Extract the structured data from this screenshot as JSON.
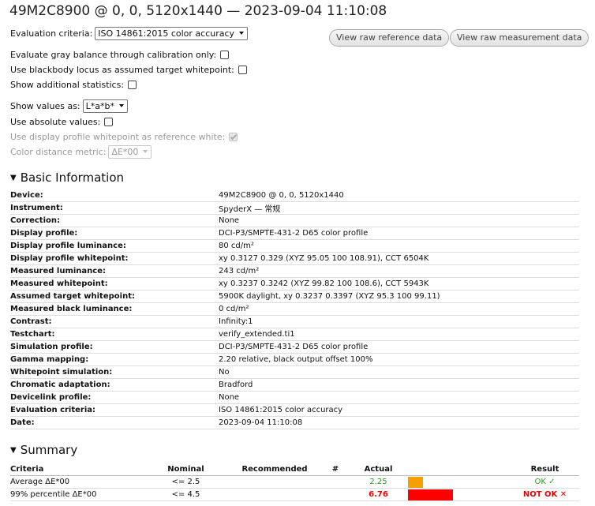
{
  "title": "49M2C8900 @ 0, 0, 5120x1440 — 2023-09-04 11:10:08",
  "controls": {
    "criteria_label": "Evaluation criteria:",
    "criteria_value": "ISO 14861:2015 color accuracy",
    "gray_balance_label": "Evaluate gray balance through calibration only:",
    "blackbody_label": "Use blackbody locus as assumed target whitepoint:",
    "additional_stats_label": "Show additional statistics:",
    "show_values_label": "Show values as:",
    "show_values_value": "L*a*b*",
    "absolute_values_label": "Use absolute values:",
    "display_profile_wp_label": "Use display profile whitepoint as reference white:",
    "color_distance_label": "Color distance metric:",
    "color_distance_value": "ΔE*00"
  },
  "buttons": {
    "raw_reference": "View raw reference data",
    "raw_measurement": "View raw measurement data"
  },
  "basic_info": {
    "heading": "Basic Information",
    "rows": [
      {
        "key": "Device:",
        "value": "49M2C8900 @ 0, 0, 5120x1440"
      },
      {
        "key": "Instrument:",
        "value": "SpyderX — 常规"
      },
      {
        "key": "Correction:",
        "value": "None"
      },
      {
        "key": "Display profile:",
        "value": "DCI-P3/SMPTE-431-2 D65 color profile"
      },
      {
        "key": "Display profile luminance:",
        "value": "80 cd/m²"
      },
      {
        "key": "Display profile whitepoint:",
        "value": "xy 0.3127 0.329 (XYZ 95.05 100 108.91), CCT 6504K"
      },
      {
        "key": "Measured luminance:",
        "value": "243 cd/m²"
      },
      {
        "key": "Measured whitepoint:",
        "value": "xy 0.3237 0.3242 (XYZ 99.82 100 108.6), CCT 5943K"
      },
      {
        "key": "Assumed target whitepoint:",
        "value": "5900K daylight, xy 0.3237 0.3397 (XYZ 95.3 100 99.11)"
      },
      {
        "key": "Measured black luminance:",
        "value": "0 cd/m²"
      },
      {
        "key": "Contrast:",
        "value": "Infinity:1"
      },
      {
        "key": "Testchart:",
        "value": "verify_extended.ti1"
      },
      {
        "key": "Simulation profile:",
        "value": "DCI-P3/SMPTE-431-2 D65 color profile"
      },
      {
        "key": "Gamma mapping:",
        "value": "2.20 relative, black output offset 100%"
      },
      {
        "key": "Whitepoint simulation:",
        "value": "No"
      },
      {
        "key": "Chromatic adaptation:",
        "value": "Bradford"
      },
      {
        "key": "Devicelink profile:",
        "value": "None"
      },
      {
        "key": "Evaluation criteria:",
        "value": "ISO 14861:2015 color accuracy"
      },
      {
        "key": "Date:",
        "value": "2023-09-04 11:10:08"
      }
    ]
  },
  "summary": {
    "heading": "Summary",
    "headers": {
      "criteria": "Criteria",
      "nominal": "Nominal",
      "recommended": "Recommended",
      "num": "#",
      "actual": "Actual",
      "result": "Result"
    },
    "rows": [
      {
        "criteria": "Average ΔE*00",
        "nominal": "<= 2.5",
        "recommended": "",
        "num": "",
        "actual": "2.25",
        "bar_fraction": 0.09,
        "bar_color": "#f5a000",
        "actual_color": "#2a9d2a",
        "result": "OK ✓",
        "result_color": "#2a9d2a"
      },
      {
        "criteria": "99% percentile ΔE*00",
        "nominal": "<= 4.5",
        "recommended": "",
        "num": "",
        "actual": "6.76",
        "bar_fraction": 0.27,
        "bar_color": "#ff0000",
        "actual_color": "#ee0000",
        "result": "NOT OK ✕",
        "result_color": "#ee0000"
      }
    ]
  }
}
